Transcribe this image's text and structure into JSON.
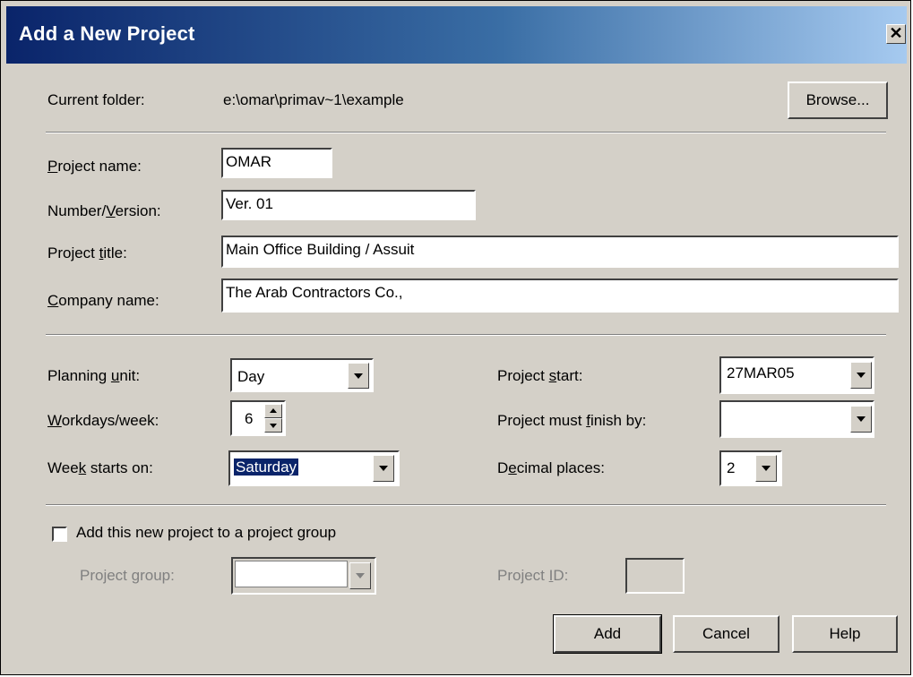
{
  "window": {
    "title": "Add a New Project",
    "close_glyph": "✕"
  },
  "folder": {
    "label": "Current folder:",
    "path": "e:\\omar\\primav~1\\example",
    "browse_label": "Browse..."
  },
  "fields": {
    "project_name": {
      "label_pre": "",
      "label_key": "P",
      "label_post": "roject name:",
      "value": "OMAR"
    },
    "number_version": {
      "label_pre": "Number/",
      "label_key": "V",
      "label_post": "ersion:",
      "value": "Ver. 01"
    },
    "project_title": {
      "label_pre": "Project ",
      "label_key": "t",
      "label_post": "itle:",
      "value": "Main Office Building / Assuit"
    },
    "company_name": {
      "label_pre": "",
      "label_key": "C",
      "label_post": "ompany name:",
      "value": "The Arab Contractors Co.,"
    }
  },
  "planning": {
    "planning_unit": {
      "label_pre": "Planning ",
      "label_key": "u",
      "label_post": "nit:",
      "value": "Day"
    },
    "workdays": {
      "label_pre": "",
      "label_key": "W",
      "label_post": "orkdays/week:",
      "value": "6"
    },
    "week_starts": {
      "label_pre": "Wee",
      "label_key": "k",
      "label_post": " starts on:",
      "value": "Saturday"
    },
    "project_start": {
      "label_pre": "Project ",
      "label_key": "s",
      "label_post": "tart:",
      "value": "27MAR05"
    },
    "must_finish": {
      "label_pre": "Project must ",
      "label_key": "f",
      "label_post": "inish by:",
      "value": ""
    },
    "decimal_places": {
      "label_pre": "D",
      "label_key": "e",
      "label_post": "cimal places:",
      "value": "2"
    }
  },
  "group": {
    "checkbox_label": "Add this new project to a project group",
    "checked": false,
    "group_label_pre": "Project ",
    "group_label_key": "g",
    "group_label_post": "roup:",
    "group_value": "",
    "id_label_pre": "Project ",
    "id_label_key": "I",
    "id_label_post": "D:",
    "id_value": ""
  },
  "buttons": {
    "add": "Add",
    "cancel": "Cancel",
    "help": "Help"
  }
}
